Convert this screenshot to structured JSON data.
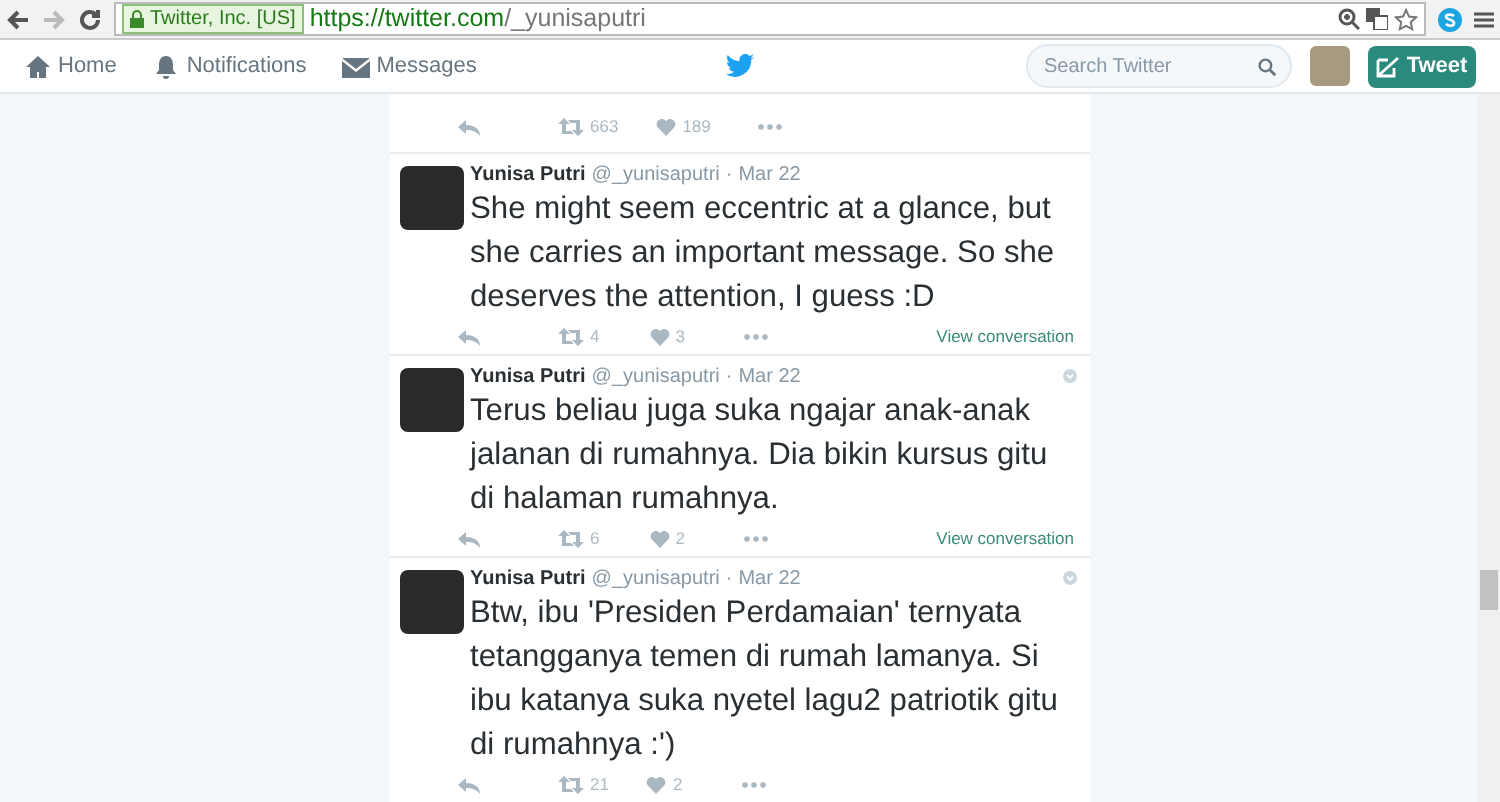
{
  "browser": {
    "security_label": "Twitter, Inc. [US]",
    "url_host": "https://twitter.com",
    "url_path": "/_yunisaputri"
  },
  "nav": {
    "items": [
      {
        "label": "Home",
        "selected": false
      },
      {
        "label": "Notifications",
        "selected": false
      },
      {
        "label": "Messages",
        "selected": false
      }
    ],
    "search": {
      "placeholder": "Search Twitter"
    },
    "tweet_button": "Tweet"
  },
  "tweets": [
    {
      "kind": "partial",
      "retweets": "663",
      "likes": "189"
    },
    {
      "kind": "full",
      "name": "Yunisa Putri",
      "handle": "@_yunisaputri",
      "separator": "·",
      "date": "Mar 22",
      "caret": false,
      "text": "She might seem eccentric at a glance, but she carries an important message. So she deserves the attention, I guess :D",
      "retweets": "4",
      "likes": "3",
      "link": "View conversation"
    },
    {
      "kind": "full",
      "name": "Yunisa Putri",
      "handle": "@_yunisaputri",
      "separator": "·",
      "date": "Mar 22",
      "caret": true,
      "text": "Terus beliau juga suka ngajar anak-anak jalanan di rumahnya. Dia bikin kursus gitu di halaman rumahnya.",
      "retweets": "6",
      "likes": "2",
      "link": "View conversation"
    },
    {
      "kind": "full",
      "name": "Yunisa Putri",
      "handle": "@_yunisaputri",
      "separator": "·",
      "date": "Mar 22",
      "caret": true,
      "text": "Btw, ibu 'Presiden Perdamaian' ternyata tetangganya temen di rumah lamanya. Si ibu katanya suka nyetel lagu2 patriotik gitu di rumahnya :')",
      "retweets": "21",
      "likes": "2"
    }
  ]
}
